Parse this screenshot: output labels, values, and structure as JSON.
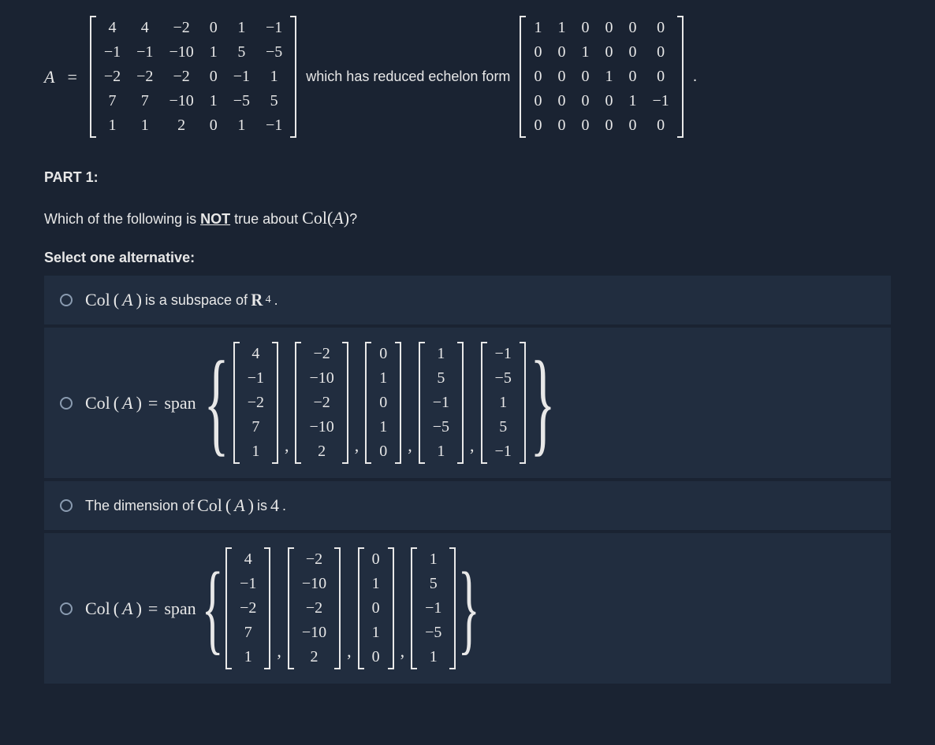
{
  "labels": {
    "A_var": "A",
    "eq": "=",
    "mid_text": "which has reduced echelon form",
    "period": ".",
    "part_label": "PART 1:",
    "question_prefix": "Which of the following is ",
    "not_word": "NOT",
    "question_suffix1": " true about ",
    "col_fn": "Col",
    "question_suffix2": "?",
    "select_label": "Select one alternative:",
    "span_word": "span",
    "R_sym": "R",
    "comma": ","
  },
  "matrices": {
    "A": [
      [
        "4",
        "4",
        "−2",
        "0",
        "1",
        "−1"
      ],
      [
        "−1",
        "−1",
        "−10",
        "1",
        "5",
        "−5"
      ],
      [
        "−2",
        "−2",
        "−2",
        "0",
        "−1",
        "1"
      ],
      [
        "7",
        "7",
        "−10",
        "1",
        "−5",
        "5"
      ],
      [
        "1",
        "1",
        "2",
        "0",
        "1",
        "−1"
      ]
    ],
    "RREF": [
      [
        "1",
        "1",
        "0",
        "0",
        "0",
        "0"
      ],
      [
        "0",
        "0",
        "1",
        "0",
        "0",
        "0"
      ],
      [
        "0",
        "0",
        "0",
        "1",
        "0",
        "0"
      ],
      [
        "0",
        "0",
        "0",
        "0",
        "1",
        "−1"
      ],
      [
        "0",
        "0",
        "0",
        "0",
        "0",
        "0"
      ]
    ]
  },
  "options": {
    "opt1": {
      "prefix": "",
      "text_after_col": " is a subspace of ",
      "R_exp": "4",
      "suffix": "."
    },
    "opt2": {
      "vectors": [
        [
          "4",
          "−1",
          "−2",
          "7",
          "1"
        ],
        [
          "−2",
          "−10",
          "−2",
          "−10",
          "2"
        ],
        [
          "0",
          "1",
          "0",
          "1",
          "0"
        ],
        [
          "1",
          "5",
          "−1",
          "−5",
          "1"
        ],
        [
          "−1",
          "−5",
          "1",
          "5",
          "−1"
        ]
      ]
    },
    "opt3": {
      "prefix": "The dimension of ",
      "suffix": " is ",
      "value": "4",
      "period": " ."
    },
    "opt4": {
      "vectors": [
        [
          "4",
          "−1",
          "−2",
          "7",
          "1"
        ],
        [
          "−2",
          "−10",
          "−2",
          "−10",
          "2"
        ],
        [
          "0",
          "1",
          "0",
          "1",
          "0"
        ],
        [
          "1",
          "5",
          "−1",
          "−5",
          "1"
        ]
      ]
    }
  }
}
